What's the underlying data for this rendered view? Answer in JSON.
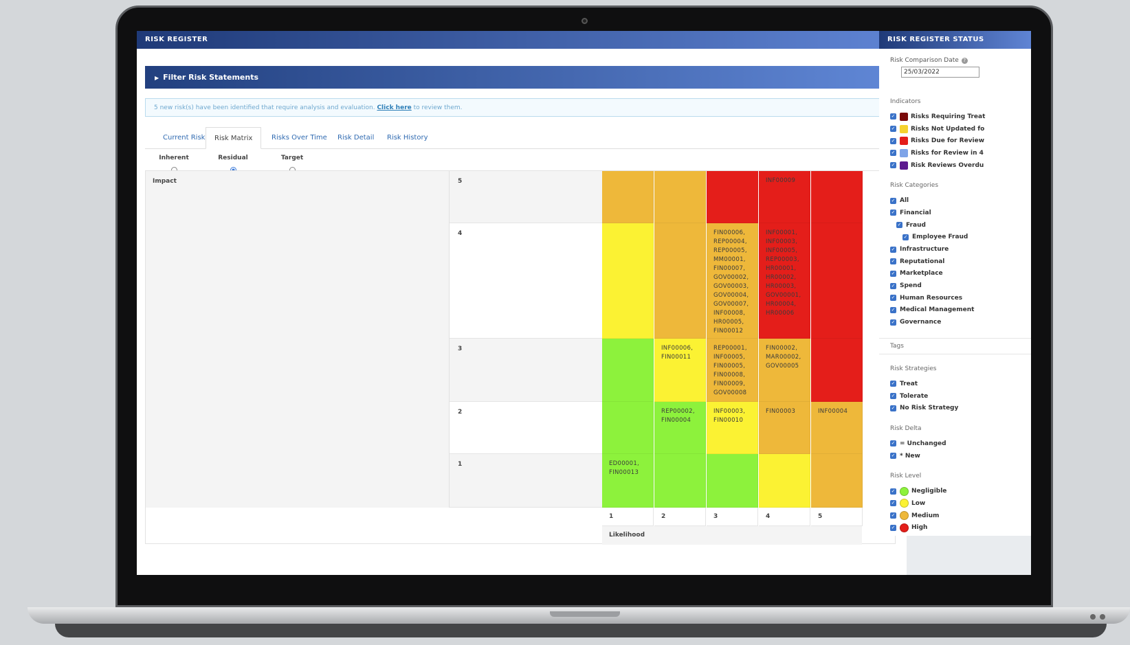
{
  "main": {
    "title": "RISK REGISTER",
    "filter_label": "Filter Risk Statements",
    "alert": {
      "text_before": "5 new risk(s) have been identified that require analysis and evaluation.",
      "link": "Click here",
      "text_after": "to review them."
    },
    "tabs": [
      "Current Risks",
      "Risk Matrix",
      "Risks Over Time",
      "Risk Detail",
      "Risk History"
    ],
    "active_tab": "Risk Matrix",
    "views": [
      {
        "label": "Inherent",
        "selected": false
      },
      {
        "label": "Residual",
        "selected": true
      },
      {
        "label": "Target",
        "selected": false
      }
    ]
  },
  "matrix": {
    "impact_label": "Impact",
    "likelihood_label": "Likelihood",
    "impact_levels": [
      "5",
      "4",
      "3",
      "2",
      "1"
    ],
    "likelihood_levels": [
      "1",
      "2",
      "3",
      "4",
      "5"
    ],
    "colors": {
      "negligible": "#8df23c",
      "low": "#fbf233",
      "medium": "#eeb83a",
      "high": "#e41e1a"
    },
    "rows": [
      {
        "impact": "5",
        "cells": [
          {
            "level": "medium",
            "text": ""
          },
          {
            "level": "medium",
            "text": ""
          },
          {
            "level": "high",
            "text": ""
          },
          {
            "level": "high",
            "text": "INF00009"
          },
          {
            "level": "high",
            "text": ""
          }
        ]
      },
      {
        "impact": "4",
        "cells": [
          {
            "level": "low",
            "text": ""
          },
          {
            "level": "medium",
            "text": ""
          },
          {
            "level": "medium",
            "text": "FIN00006, REP00004, REP00005, MM00001, FIN00007, GOV00002, GOV00003, GOV00004, GOV00007, INF00008, HR00005, FIN00012"
          },
          {
            "level": "high",
            "text": "INF00001, INF00003, INF00005, REP00003, HR00001, HR00002, HR00003, GOV00001, HR00004, HR00006"
          },
          {
            "level": "high",
            "text": ""
          }
        ]
      },
      {
        "impact": "3",
        "cells": [
          {
            "level": "negligible",
            "text": ""
          },
          {
            "level": "low",
            "text": "INF00006, FIN00011"
          },
          {
            "level": "medium",
            "text": "REP00001, INF00005, FIN00005, FIN00008, FIN00009, GOV00008"
          },
          {
            "level": "medium",
            "text": "FIN00002, MAR00002, GOV00005"
          },
          {
            "level": "high",
            "text": ""
          }
        ]
      },
      {
        "impact": "2",
        "cells": [
          {
            "level": "negligible",
            "text": ""
          },
          {
            "level": "negligible",
            "text": "REP00002, FIN00004"
          },
          {
            "level": "low",
            "text": "INF00003, FIN00010"
          },
          {
            "level": "medium",
            "text": "FIN00003"
          },
          {
            "level": "medium",
            "text": "INF00004"
          }
        ]
      },
      {
        "impact": "1",
        "cells": [
          {
            "level": "negligible",
            "text": "ED00001, FIN00013"
          },
          {
            "level": "negligible",
            "text": ""
          },
          {
            "level": "negligible",
            "text": ""
          },
          {
            "level": "low",
            "text": ""
          },
          {
            "level": "medium",
            "text": ""
          }
        ]
      }
    ]
  },
  "status": {
    "title": "RISK REGISTER STATUS",
    "comparison_date_label": "Risk Comparison Date",
    "comparison_date": "25/03/2022",
    "indicators_title": "Indicators",
    "indicators": [
      {
        "label": "Risks Requiring Treat",
        "color": "#7a0a0a"
      },
      {
        "label": "Risks Not Updated fo",
        "color": "#f5d22f"
      },
      {
        "label": "Risks Due for Review",
        "color": "#e41e1a"
      },
      {
        "label": "Risks for Review in 4",
        "color": "#7ea4e8"
      },
      {
        "label": "Risk Reviews Overdu",
        "color": "#5c1a8f"
      }
    ],
    "categories_title": "Risk Categories",
    "categories": [
      {
        "label": "All",
        "indent": 0
      },
      {
        "label": "Financial",
        "indent": 0
      },
      {
        "label": "Fraud",
        "indent": 1
      },
      {
        "label": "Employee Fraud",
        "indent": 2
      },
      {
        "label": "Infrastructure",
        "indent": 0
      },
      {
        "label": "Reputational",
        "indent": 0
      },
      {
        "label": "Marketplace",
        "indent": 0
      },
      {
        "label": "Spend",
        "indent": 0
      },
      {
        "label": "Human Resources",
        "indent": 0
      },
      {
        "label": "Medical Management",
        "indent": 0
      },
      {
        "label": "Governance",
        "indent": 0
      }
    ],
    "tags_title": "Tags",
    "strategies_title": "Risk Strategies",
    "strategies": [
      "Treat",
      "Tolerate",
      "No Risk Strategy"
    ],
    "delta_title": "Risk Delta",
    "delta": [
      "= Unchanged",
      "* New"
    ],
    "level_title": "Risk Level",
    "levels": [
      {
        "label": "Negligible",
        "color": "#8df23c"
      },
      {
        "label": "Low",
        "color": "#fbf233"
      },
      {
        "label": "Medium",
        "color": "#eeb83a"
      },
      {
        "label": "High",
        "color": "#e41e1a"
      }
    ]
  }
}
